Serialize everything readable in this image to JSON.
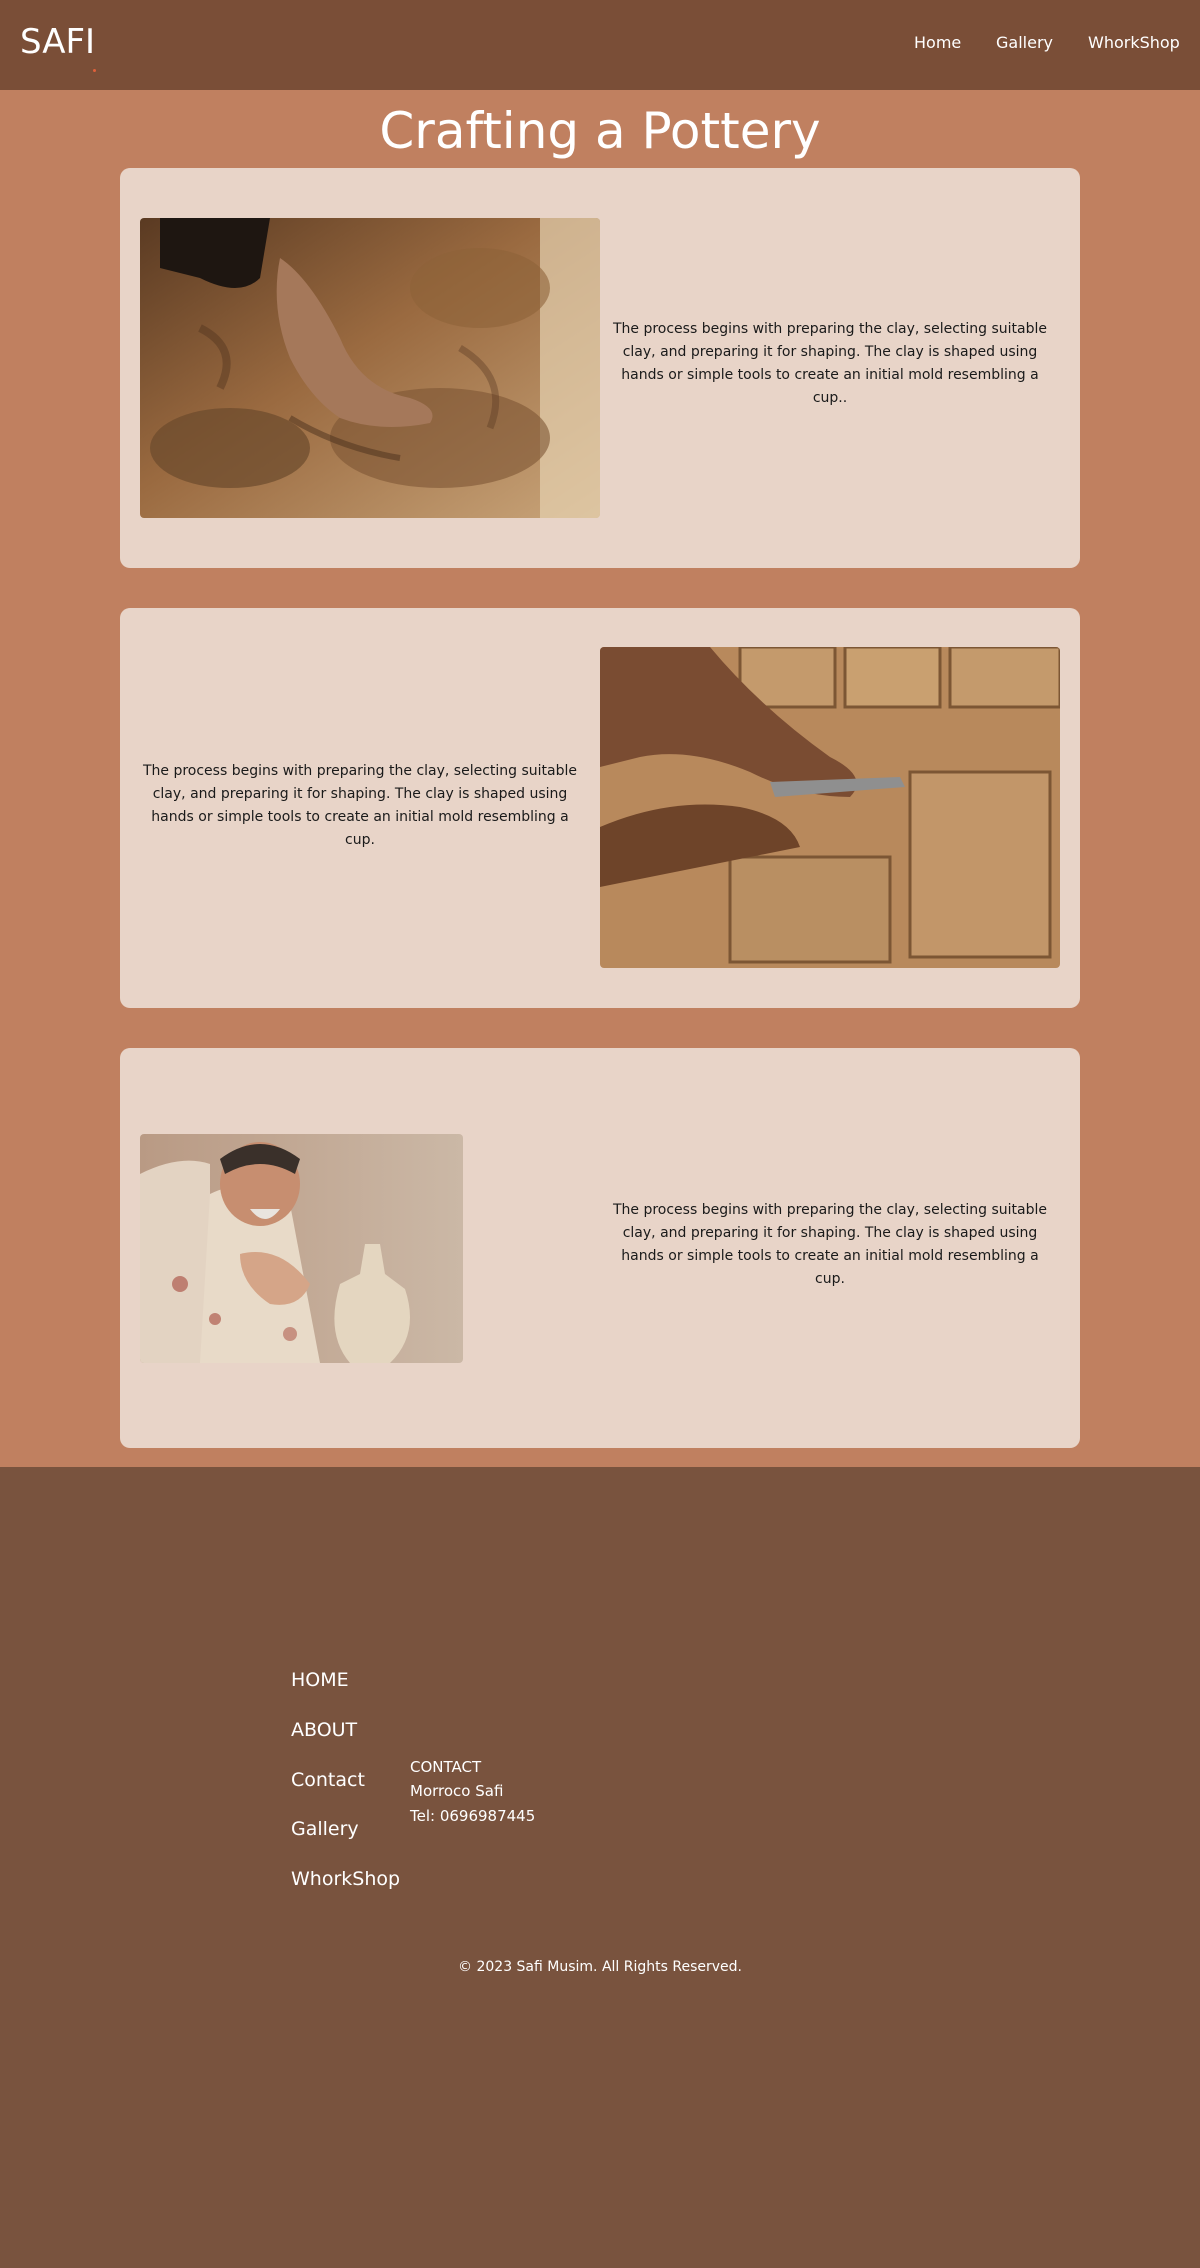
{
  "header": {
    "brand": "SAFI",
    "nav": [
      "Home",
      "Gallery",
      "WhorkShop"
    ]
  },
  "main": {
    "title": "Crafting a Pottery",
    "sections": [
      {
        "text": "The process begins with preparing the clay, selecting suitable clay, and preparing it for shaping. The clay is shaped using hands or simple tools to create an initial mold resembling a cup..",
        "image": "foot-kneading-clay-photo"
      },
      {
        "text": "The process begins with preparing the clay, selecting suitable clay, and preparing it for shaping. The clay is shaped using hands or simple tools to create an initial mold resembling a cup.",
        "image": "hands-cutting-clay-bricks-photo"
      },
      {
        "text": "The process begins with preparing the clay, selecting suitable clay, and preparing it for shaping. The clay is shaped using hands or simple tools to create an initial mold resembling a cup.",
        "image": "potter-shaping-vase-photo"
      }
    ]
  },
  "footer": {
    "links": [
      "HOME",
      "ABOUT",
      "Contact",
      "Gallery",
      "WhorkShop"
    ],
    "contact": {
      "heading": "CONTACT",
      "location": "Morroco Safi",
      "phone": "Tel: 0696987445"
    },
    "copyright": "© 2023 Safi Musim. All Rights Reserved."
  },
  "colors": {
    "navbar": "#7a4e37",
    "page_background": "#c08060",
    "card_background": "#e8d4c8",
    "footer": "#79533e",
    "accent_dot": "#e0603a"
  }
}
